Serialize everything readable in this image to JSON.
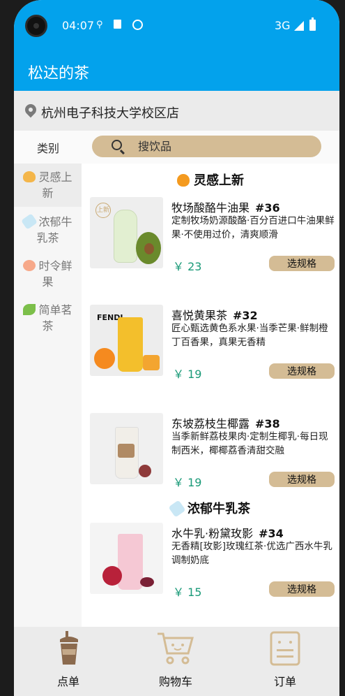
{
  "status": {
    "time": "04:07",
    "network": "3G"
  },
  "app": {
    "title": "松达的茶"
  },
  "shop": {
    "name": "杭州电子科技大学校区店"
  },
  "categories_title": "类别",
  "search": {
    "placeholder": "搜饮品"
  },
  "sidebar": {
    "items": [
      {
        "label_line1": "灵感上",
        "label_line2": "新",
        "icon": "heart-emoji",
        "color": "#f4b64a",
        "active": true
      },
      {
        "label_line1": "浓郁牛",
        "label_line2": "乳茶",
        "icon": "baby-bottle-emoji",
        "color": "#c9e7f5",
        "active": false
      },
      {
        "label_line1": "时令鲜",
        "label_line2": "果",
        "icon": "peach-emoji",
        "color": "#f7a98a",
        "active": false
      },
      {
        "label_line1": "简单茗",
        "label_line2": "茶",
        "icon": "seedling-emoji",
        "color": "#7cbf4a",
        "active": false
      }
    ]
  },
  "sections": [
    {
      "title": "灵感上新",
      "icon": "orange-heart-emoji",
      "color": "#f49a1f"
    },
    {
      "title": "浓郁牛乳茶",
      "icon": "baby-bottle-emoji",
      "color": "#c9e7f5"
    }
  ],
  "products": [
    {
      "name": "牧场酸酪牛油果",
      "num": "#36",
      "desc": "定制牧场奶源酸酪·百分百进口牛油果鲜果·不使用过价，清爽顺滑",
      "price": "￥ 23",
      "button": "选规格",
      "tag": "上新"
    },
    {
      "name": "喜悦黄果茶",
      "num": "#32",
      "desc": "匠心甄选黄色系水果·当季芒果·鲜制橙丁百香果，真果无香精",
      "price": "￥ 19",
      "button": "选规格",
      "brand": "FENDI"
    },
    {
      "name": "东坡荔枝生椰露",
      "num": "#38",
      "desc": "当季新鲜荔枝果肉·定制生椰乳·每日现制西米，椰椰荔香清甜交融",
      "price": "￥ 19",
      "button": "选规格"
    },
    {
      "name": "水牛乳·粉黛玫影",
      "num": "#34",
      "desc": "无香精[玫影]玫瑰红茶·优选广西水牛乳调制奶底",
      "price": "￥ 15",
      "button": "选规格"
    }
  ],
  "nav": [
    {
      "label": "点单",
      "icon": "tea-cup-icon"
    },
    {
      "label": "购物车",
      "icon": "cart-icon"
    },
    {
      "label": "订单",
      "icon": "order-list-icon"
    }
  ],
  "colors": {
    "primary": "#03a2ec",
    "accent": "#d4bc95",
    "price": "#1a9a78"
  }
}
